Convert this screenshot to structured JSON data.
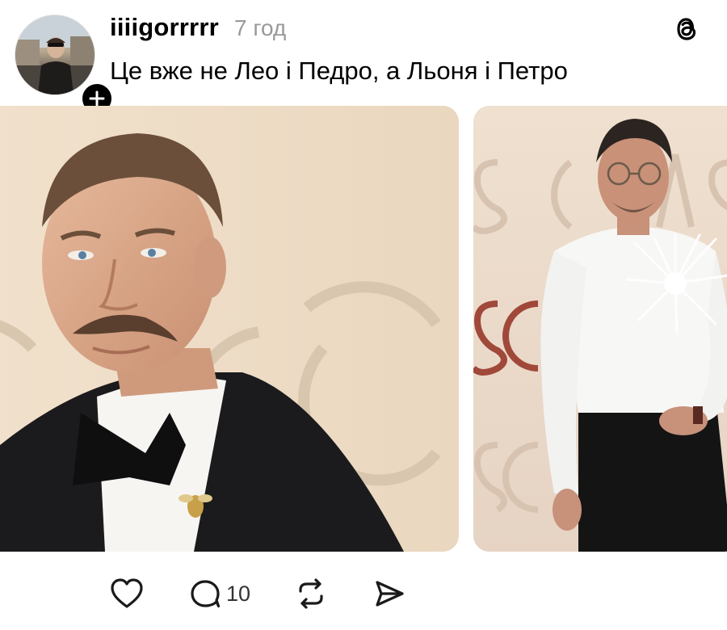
{
  "post": {
    "author": {
      "username": "iiiigorrrrr",
      "avatar_icon": "avatar-photo",
      "follow_icon": "plus-icon"
    },
    "time": "7 год",
    "text": "Це вже не Лео і Педро, а Льоня і Петро",
    "brand_icon": "threads-logo-icon",
    "media": [
      {
        "type": "photo",
        "backdrop_text": "OSCARS"
      },
      {
        "type": "photo",
        "backdrop_text": "OSCARS"
      }
    ],
    "actions": {
      "like_icon": "heart-icon",
      "reply_icon": "speech-bubble-icon",
      "reply_count": "10",
      "repost_icon": "repost-icon",
      "share_icon": "send-icon"
    }
  },
  "colors": {
    "text": "#000000",
    "muted": "#999999",
    "backdrop": "#eedcc5"
  }
}
